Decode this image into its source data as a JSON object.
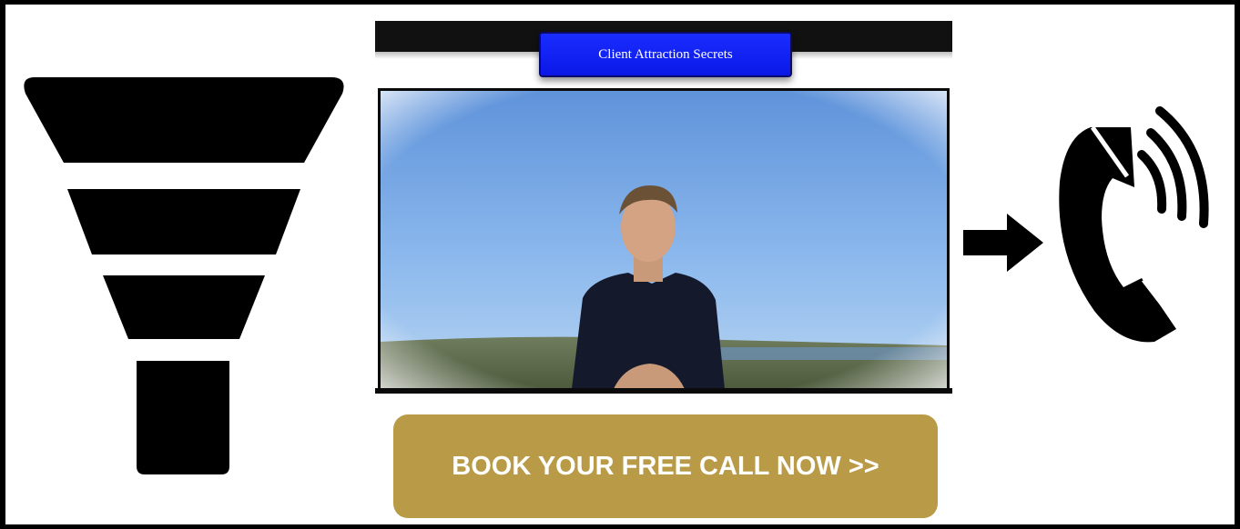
{
  "video": {
    "title": "Client Attraction Secrets"
  },
  "cta": {
    "label": "BOOK YOUR FREE CALL NOW >>"
  },
  "colors": {
    "page_border": "#000000",
    "background": "#ffffff",
    "icon_fill": "#000000",
    "title_tab": "#1a2dff",
    "cta_button": "#b99b47",
    "cta_text": "#ffffff"
  },
  "icons": {
    "left": "funnel-icon",
    "middle": "arrow-right-icon",
    "right": "phone-ringing-icon"
  }
}
